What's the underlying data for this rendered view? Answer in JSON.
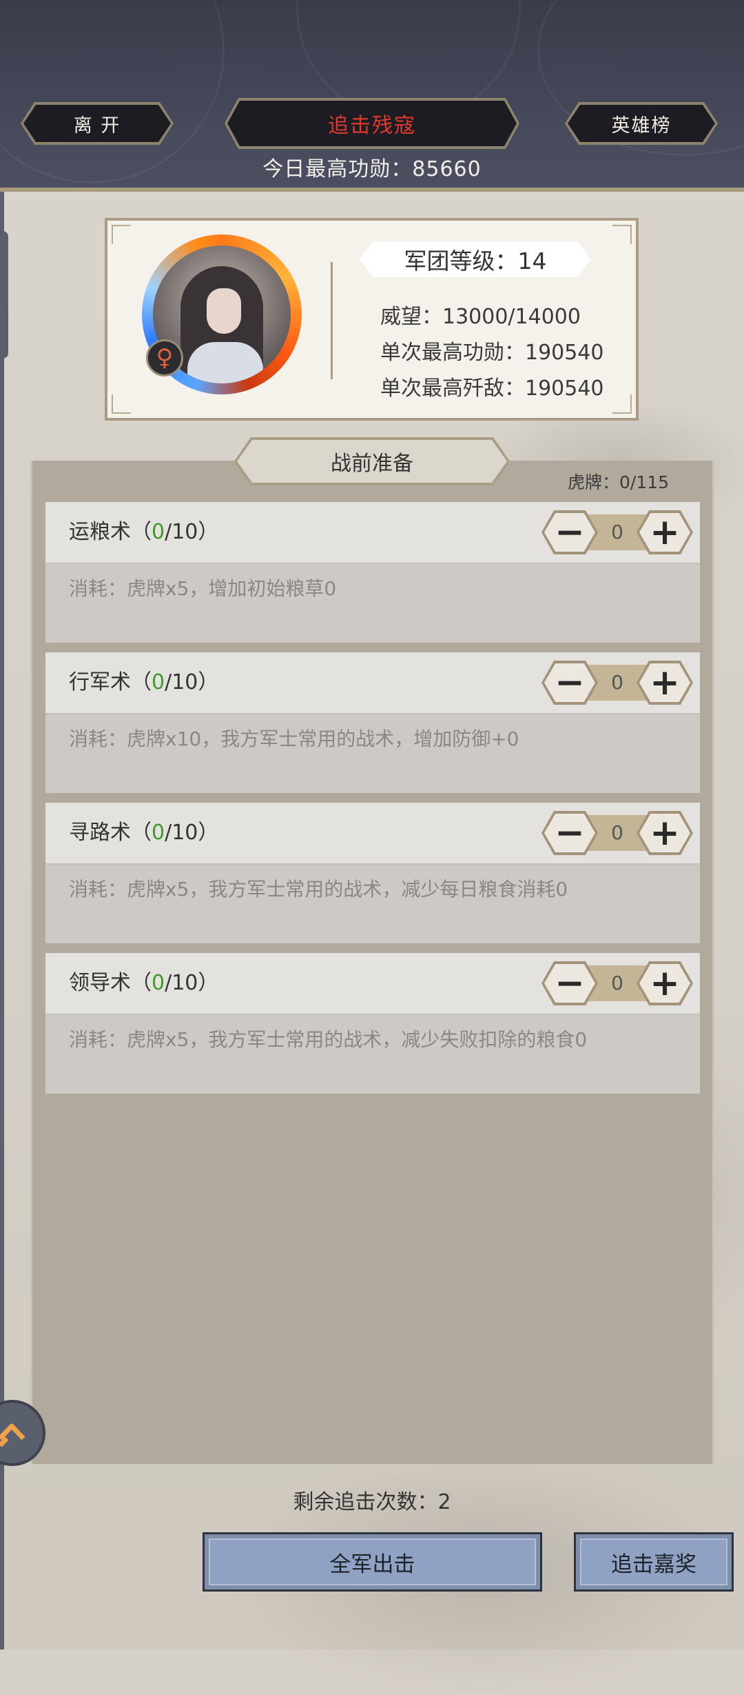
{
  "header": {
    "leave_label": "离 开",
    "title": "追击残寇",
    "ranking_label": "英雄榜",
    "best_today": "今日最高功勋：85660"
  },
  "profile": {
    "gender_symbol": "♀",
    "level": "军团等级：14",
    "prestige": "威望：13000/14000",
    "best_merit": "单次最高功勋：190540",
    "best_kills": "单次最高歼敌：190540"
  },
  "prep": {
    "title": "战前准备",
    "tiger_tokens": "虎牌：0/115",
    "skills": [
      {
        "name": "运粮术（",
        "current": "0",
        "max": "/10）",
        "desc": "消耗：虎牌x5，增加初始粮草0",
        "value": "0"
      },
      {
        "name": "行军术（",
        "current": "0",
        "max": "/10）",
        "desc": "消耗：虎牌x10，我方军士常用的战术，增加防御+0",
        "value": "0"
      },
      {
        "name": "寻路术（",
        "current": "0",
        "max": "/10）",
        "desc": "消耗：虎牌x5，我方军士常用的战术，减少每日粮食消耗0",
        "value": "0"
      },
      {
        "name": "领导术（",
        "current": "0",
        "max": "/10）",
        "desc": "消耗：虎牌x5，我方军士常用的战术，减少失败扣除的粮食0",
        "value": "0"
      }
    ],
    "minus_symbol": "−",
    "plus_symbol": "+"
  },
  "footer": {
    "remaining": "剩余追击次数：2",
    "attack_label": "全军出击",
    "reward_label": "追击嘉奖"
  },
  "icons": {
    "float": "chevron-up-icon"
  },
  "colors": {
    "title_red": "#e2392d",
    "level_green": "#3e9b2a",
    "button_blue": "#8fa2c4"
  }
}
